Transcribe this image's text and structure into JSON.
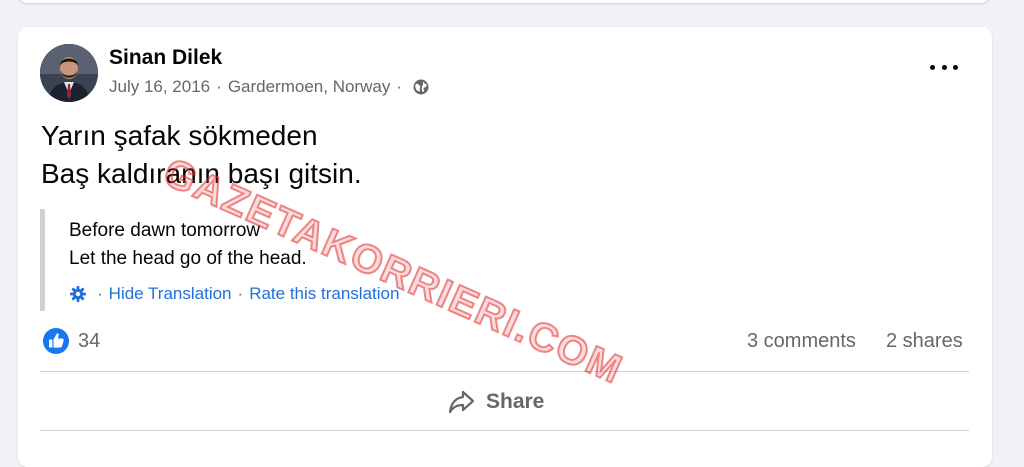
{
  "post": {
    "author": "Sinan Dilek",
    "date": "July 16, 2016",
    "location": "Gardermoen, Norway",
    "separator": "·",
    "privacy_icon": "globe-icon",
    "more_icon": "more-options-icon",
    "text_lines": [
      "Yarın şafak sökmeden",
      "Baş kaldıranın başı gitsin."
    ]
  },
  "translation": {
    "lines": [
      "Before dawn tomorrow",
      "Let the head go of the head."
    ],
    "settings_icon": "gear-icon",
    "hide_label": "Hide Translation",
    "rate_label": "Rate this translation"
  },
  "stats": {
    "like_icon": "like-icon",
    "likes": "34",
    "comments": "3 comments",
    "shares": "2 shares"
  },
  "actions": {
    "share_icon": "share-icon",
    "share_label": "Share"
  },
  "watermark": "GAZETAKORRIERI.COM",
  "colors": {
    "link": "#216fdb",
    "like": "#1877f2",
    "secondary_text": "#65676b",
    "watermark": "#e02d2d"
  }
}
